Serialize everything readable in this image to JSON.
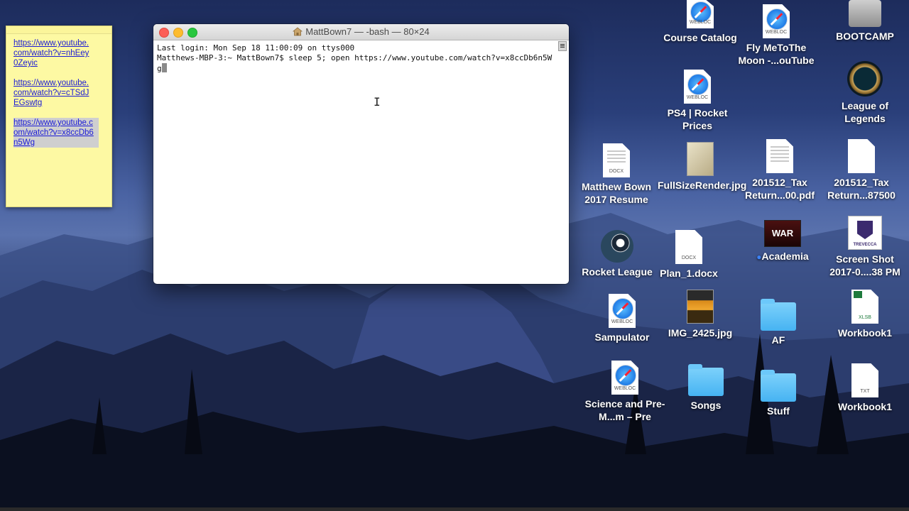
{
  "sticky_note": {
    "links": [
      "https://www.youtube.com/watch?v=nhEey0Zeyic",
      "https://www.youtube.com/watch?v=cTSdJEGswtg",
      "https://www.youtube.com/watch?v=x8ccDb6n5Wg"
    ],
    "selected_index": 2
  },
  "terminal": {
    "title": "MattBown7 — -bash — 80×24",
    "lines": [
      "Last login: Mon Sep 18 11:00:09 on ttys000",
      "Matthews-MBP-3:~ MattBown7$ sleep 5; open https://www.youtube.com/watch?v=x8ccDb6n5Wg"
    ]
  },
  "desktop_icons": [
    {
      "label": "Course Catalog",
      "type": "webloc"
    },
    {
      "label": "Fly MeToThe Moon -...ouTube",
      "type": "webloc"
    },
    {
      "label": "BOOTCAMP",
      "type": "drive"
    },
    {
      "label": "PS4 | Rocket Prices",
      "type": "webloc"
    },
    {
      "label": "League of Legends",
      "type": "app"
    },
    {
      "label": "Matthew Bown 2017 Resume",
      "type": "docx"
    },
    {
      "label": "FullSizeRender.jpg",
      "type": "image"
    },
    {
      "label": "201512_Tax Return...00.pdf",
      "type": "pdf"
    },
    {
      "label": "201512_Tax Return...87500",
      "type": "file"
    },
    {
      "label": "Rocket League",
      "type": "app"
    },
    {
      "label": "Plan_1.docx",
      "type": "docx"
    },
    {
      "label": "Academia",
      "type": "app"
    },
    {
      "label": "Screen Shot 2017-0....38 PM",
      "type": "image"
    },
    {
      "label": "Sampulator",
      "type": "webloc"
    },
    {
      "label": "IMG_2425.jpg",
      "type": "image"
    },
    {
      "label": "AF",
      "type": "folder"
    },
    {
      "label": "Workbook1",
      "type": "xlsb"
    },
    {
      "label": "Science and Pre-M...m – Pre",
      "type": "webloc"
    },
    {
      "label": "Songs",
      "type": "folder"
    },
    {
      "label": "Stuff",
      "type": "folder"
    },
    {
      "label": "Workbook1",
      "type": "txt"
    }
  ],
  "file_tags": {
    "webloc": "WEBLOC",
    "docx": "DOCX",
    "xlsb": "XLSB",
    "txt": "TXT",
    "war": "WAR",
    "trevecca": "TREVECCA"
  }
}
